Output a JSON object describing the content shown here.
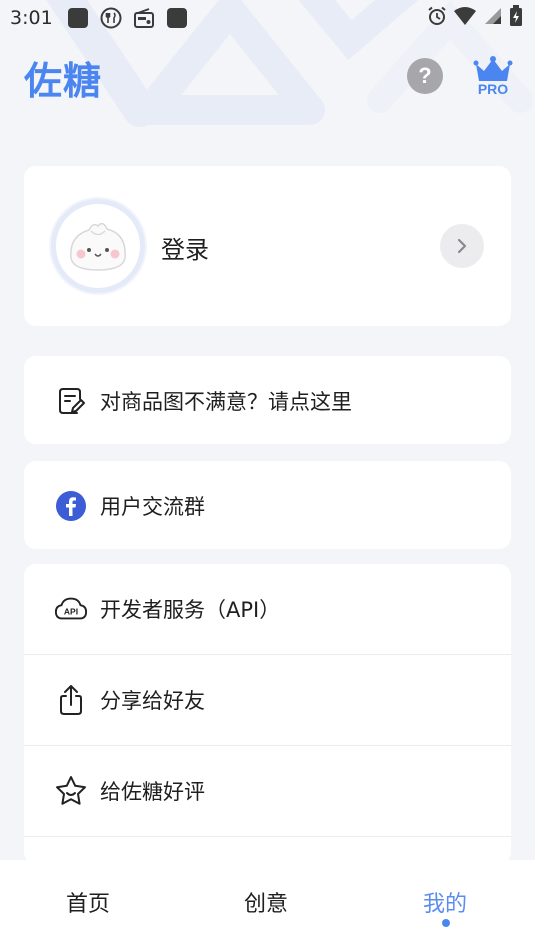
{
  "status_bar": {
    "time": "3:01",
    "left_icons": [
      "app-notification-icon",
      "restaurant-icon",
      "radio-icon",
      "app-notification-icon"
    ],
    "right_icons": [
      "alarm-icon",
      "wifi-icon",
      "cellular-signal-icon",
      "battery-icon"
    ]
  },
  "header": {
    "title": "佐糖",
    "help_label": "?",
    "pro_label": "PRO"
  },
  "login": {
    "label": "登录",
    "avatar_icon": "dumpling-mascot-icon"
  },
  "menu": {
    "feedback": {
      "label": "对商品图不满意？请点这里",
      "icon": "edit-note-icon"
    },
    "community": {
      "label": "用户交流群",
      "icon": "facebook-icon"
    },
    "developer_api": {
      "label": "开发者服务（API）",
      "icon": "cloud-api-icon"
    },
    "share": {
      "label": "分享给好友",
      "icon": "share-icon"
    },
    "rate": {
      "label": "给佐糖好评",
      "icon": "star-icon"
    }
  },
  "bottom_nav": {
    "tabs": [
      {
        "label": "首页",
        "active": false
      },
      {
        "label": "创意",
        "active": false
      },
      {
        "label": "我的",
        "active": true
      }
    ]
  },
  "colors": {
    "accent": "#4b86f0",
    "background": "#f4f5f8",
    "facebook": "#3c5dd6"
  }
}
